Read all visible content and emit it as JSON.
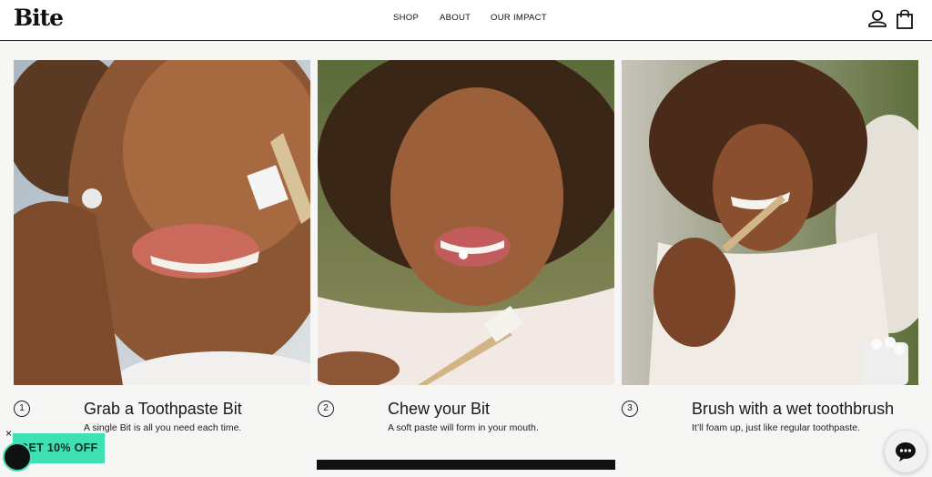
{
  "header": {
    "logo": "Bite",
    "nav": [
      {
        "label": "SHOP"
      },
      {
        "label": "ABOUT"
      },
      {
        "label": "OUR IMPACT"
      }
    ],
    "icons": [
      "user-icon",
      "shopping-bag-icon"
    ]
  },
  "steps": [
    {
      "number": "1",
      "title": "Grab a Toothpaste Bit",
      "desc": "A single Bit is all you need each time."
    },
    {
      "number": "2",
      "title": "Chew your Bit",
      "desc": "A soft paste will form in your mouth."
    },
    {
      "number": "3",
      "title": "Brush with a wet toothbrush",
      "desc": "It’ll foam up, just like regular toothpaste."
    }
  ],
  "promo": {
    "label": "GET 10% OFF",
    "close": "×"
  },
  "colors": {
    "promo": "#3ee0b4",
    "background": "#f6f6f4",
    "text": "#1a1a1a"
  },
  "icons": {
    "chat": "chat-bubble-icon"
  }
}
